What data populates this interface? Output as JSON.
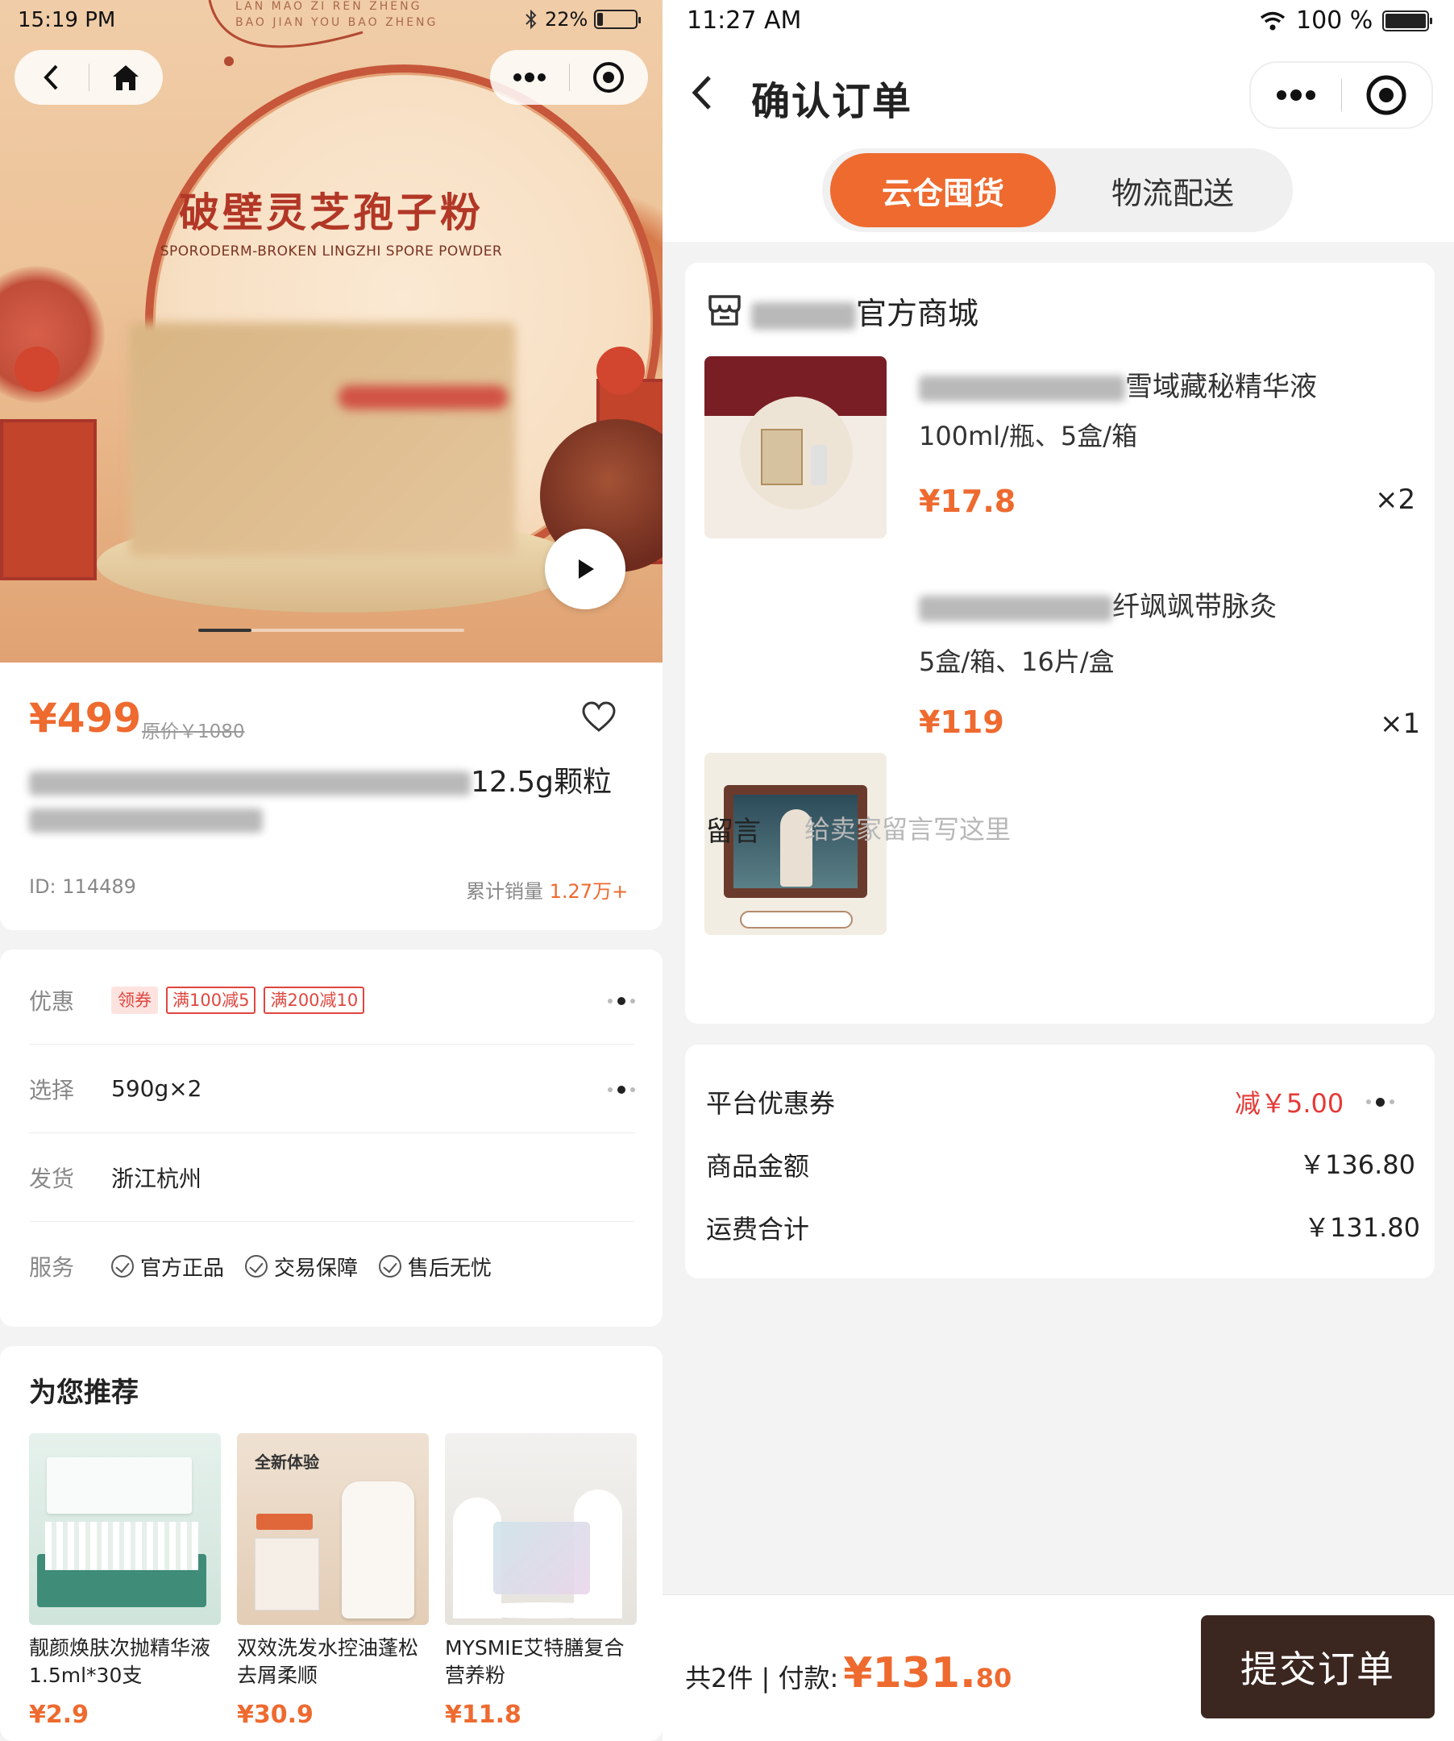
{
  "left": {
    "status": {
      "time": "15:19 PM",
      "battery": "22%",
      "battery_level": 0.22
    },
    "hero": {
      "brand_line1": "LAN MAO ZI REN ZHENG",
      "brand_line2": "BAO JIAN YOU BAO ZHENG",
      "title": "破壁灵芝孢子粉",
      "subtitle": "SPORODERM-BROKEN LINGZHI SPORE POWDER",
      "carousel_progress": 0.2
    },
    "product": {
      "price": "¥499",
      "original_price": "原价￥1080",
      "title_visible": "12.5g颗粒",
      "id": "ID: 114489",
      "sales_label": "累计销量",
      "sales_value": "1.27万+"
    },
    "options": {
      "discount_label": "优惠",
      "discount_tags": [
        "领券",
        "满100减5",
        "满200减10"
      ],
      "select_label": "选择",
      "select_value": "590g×2",
      "ship_label": "发货",
      "ship_value": "浙江杭州",
      "service_label": "服务",
      "services": [
        "官方正品",
        "交易保障",
        "售后无忧"
      ]
    },
    "recommend": {
      "title": "为您推荐",
      "items": [
        {
          "name": "靓颜焕肤次抛精华液1.5ml*30支",
          "price": "¥2.9"
        },
        {
          "name": "双效洗发水控油蓬松去屑柔顺",
          "price": "¥30.9",
          "img_text": "全新体验"
        },
        {
          "name": "MYSMIE艾特膳复合营养粉",
          "price": "¥11.8"
        }
      ]
    }
  },
  "right": {
    "status": {
      "time": "11:27 AM",
      "battery": "100 %",
      "battery_level": 1.0
    },
    "title": "确认订单",
    "tabs": [
      "云仓囤货",
      "物流配送"
    ],
    "shop_suffix": "官方商城",
    "items": [
      {
        "name_visible": "雪域藏秘精华液",
        "spec": "100ml/瓶、5盒/箱",
        "price": "¥17.8",
        "qty": "×2"
      },
      {
        "name_visible": "纤飒飒带脉灸",
        "spec": "5盒/箱、16片/盒",
        "price": "¥119",
        "qty": "×1"
      }
    ],
    "message": {
      "label": "留言",
      "placeholder": "给卖家留言写这里"
    },
    "summary": {
      "coupon_label": "平台优惠券",
      "coupon_value": "减￥5.00",
      "goods_label": "商品金额",
      "goods_value": "￥136.80",
      "shipping_label": "运费合计",
      "shipping_value": "￥131.80"
    },
    "footer": {
      "count_text": "共2件 | 付款:",
      "pay_int": "¥131.",
      "pay_dec": "80",
      "submit": "提交订单"
    }
  },
  "colors": {
    "accent": "#ee6a2f",
    "red": "#e0463f",
    "dark_button": "#3b2620"
  }
}
